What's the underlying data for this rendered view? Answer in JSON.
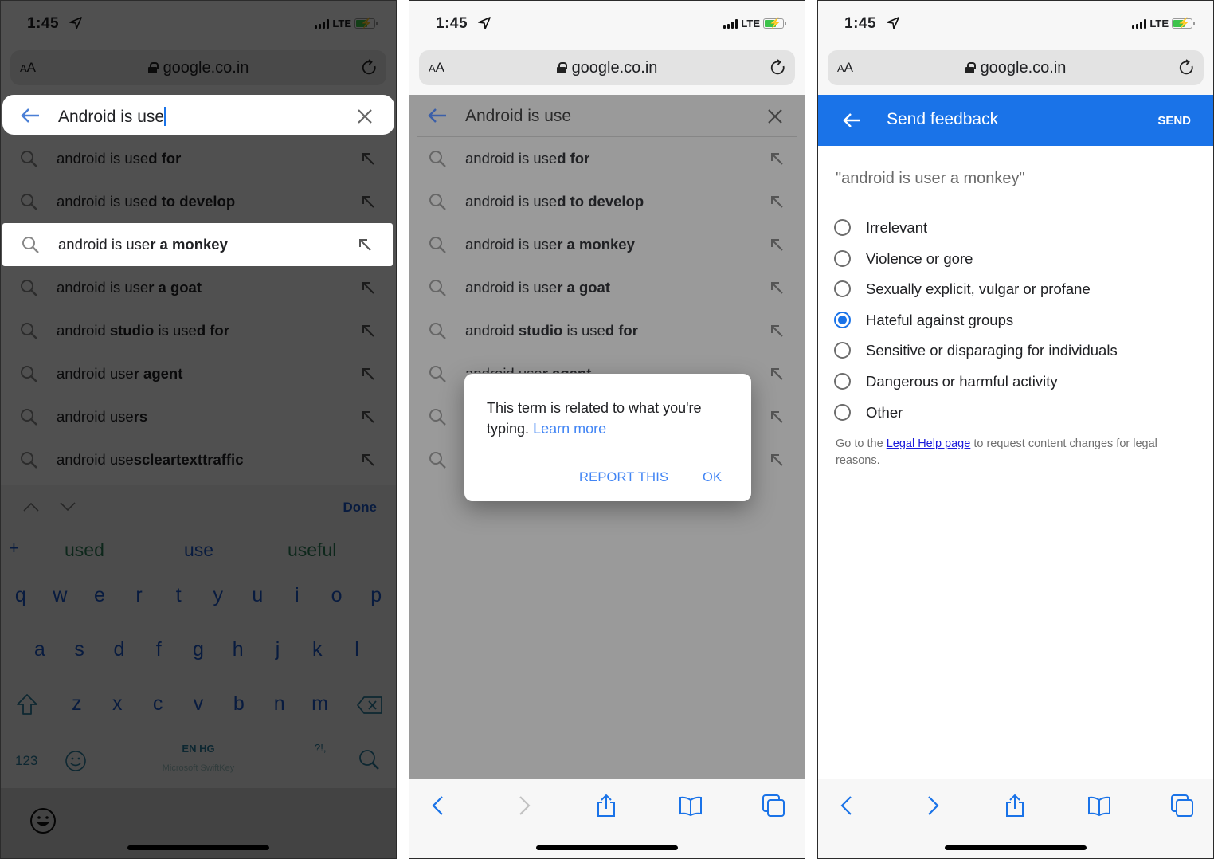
{
  "colors": {
    "accent_blue": "#1a73e8",
    "link_blue": "#4285f4",
    "battery_green": "#3cc34a"
  },
  "status_bar": {
    "time": "1:45",
    "network": "LTE"
  },
  "url_bar": {
    "text_size_label_small": "A",
    "text_size_label_large": "A",
    "host": "google.co.in"
  },
  "panel1": {
    "search_query": "Android is use",
    "suggestions": [
      {
        "plain": "android is use",
        "bold": "d for",
        "tail_plain": "",
        "tail_bold": ""
      },
      {
        "plain": "android is use",
        "bold": "d to develop",
        "tail_plain": "",
        "tail_bold": ""
      },
      {
        "plain": "android is use",
        "bold": "r a monkey",
        "tail_plain": "",
        "tail_bold": ""
      },
      {
        "plain": "android is use",
        "bold": "r a goat",
        "tail_plain": "",
        "tail_bold": ""
      },
      {
        "plain": "android ",
        "bold": "studio",
        "tail_plain": " is use",
        "tail_bold": "d for"
      },
      {
        "plain": "android use",
        "bold": "r agent",
        "tail_plain": "",
        "tail_bold": ""
      },
      {
        "plain": "android use",
        "bold": "rs",
        "tail_plain": "",
        "tail_bold": ""
      },
      {
        "plain": "android use",
        "bold": "scleartexttraffic",
        "tail_plain": "",
        "tail_bold": ""
      }
    ],
    "highlighted_index": 2,
    "keyboard": {
      "done_label": "Done",
      "plus": "+",
      "predictions": [
        "used",
        "use",
        "useful"
      ],
      "row1": [
        "q",
        "w",
        "e",
        "r",
        "t",
        "y",
        "u",
        "i",
        "o",
        "p"
      ],
      "row2": [
        "a",
        "s",
        "d",
        "f",
        "g",
        "h",
        "j",
        "k",
        "l"
      ],
      "row3": [
        "z",
        "x",
        "c",
        "v",
        "b",
        "n",
        "m"
      ],
      "numbers_key": "123",
      "language": "EN HG",
      "brand": "Microsoft SwiftKey",
      "punct_key": "?!,"
    }
  },
  "panel2": {
    "search_query": "Android is use",
    "suggestions": [
      {
        "plain": "android is use",
        "bold": "d for",
        "tail_plain": "",
        "tail_bold": ""
      },
      {
        "plain": "android is use",
        "bold": "d to develop",
        "tail_plain": "",
        "tail_bold": ""
      },
      {
        "plain": "android is use",
        "bold": "r a monkey",
        "tail_plain": "",
        "tail_bold": ""
      },
      {
        "plain": "android is use",
        "bold": "r a goat",
        "tail_plain": "",
        "tail_bold": ""
      },
      {
        "plain": "android ",
        "bold": "studio",
        "tail_plain": " is use",
        "tail_bold": "d for"
      },
      {
        "plain": "android use",
        "bold": "r agent",
        "tail_plain": "",
        "tail_bold": ""
      },
      {
        "plain": "",
        "bold": "",
        "tail_plain": "",
        "tail_bold": ""
      },
      {
        "plain": "",
        "bold": "",
        "tail_plain": "",
        "tail_bold": ""
      }
    ],
    "dialog": {
      "message": "This term is related to what you're typing.",
      "learn_more": "Learn more",
      "report_label": "REPORT THIS",
      "ok_label": "OK"
    }
  },
  "panel3": {
    "header_title": "Send feedback",
    "send_label": "SEND",
    "quoted_term": "\"android is user a monkey\"",
    "options": [
      {
        "label": "Irrelevant",
        "selected": false
      },
      {
        "label": "Violence or gore",
        "selected": false
      },
      {
        "label": "Sexually explicit, vulgar or profane",
        "selected": false
      },
      {
        "label": "Hateful against groups",
        "selected": true
      },
      {
        "label": "Sensitive or disparaging for individuals",
        "selected": false
      },
      {
        "label": "Dangerous or harmful activity",
        "selected": false
      },
      {
        "label": "Other",
        "selected": false
      }
    ],
    "legal_prefix": "Go to the ",
    "legal_link": "Legal Help page",
    "legal_suffix": " to request content changes for legal reasons."
  },
  "toolbar_icons": [
    "back-icon",
    "forward-icon",
    "share-icon",
    "bookmarks-icon",
    "tabs-icon"
  ]
}
